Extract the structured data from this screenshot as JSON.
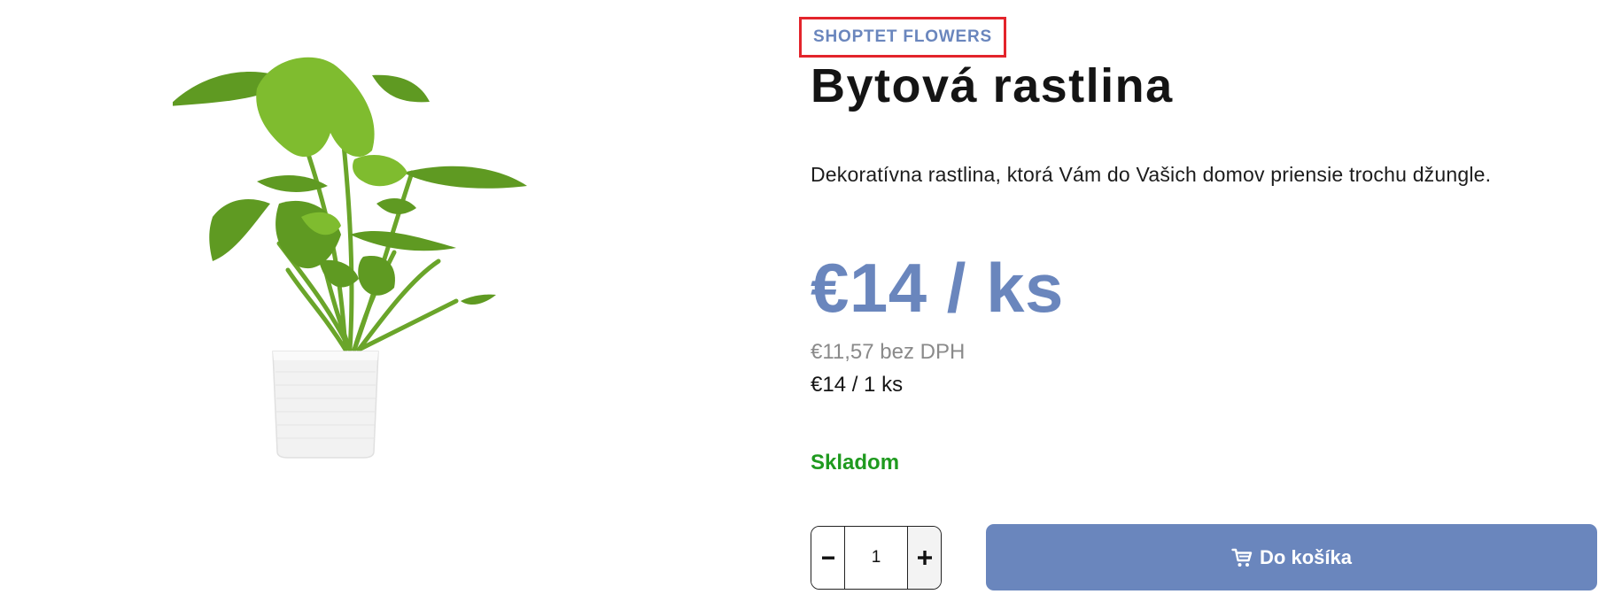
{
  "product": {
    "brand": "SHOPTET FLOWERS",
    "title": "Bytová rastlina",
    "description": "Dekoratívna rastlina, ktorá Vám do Vašich domov priensie trochu džungle.",
    "image_alt": "Monstera v bielom kvetináči"
  },
  "pricing": {
    "price_main": "€14 / ks",
    "price_without_vat": "€11,57 bez DPH",
    "price_per_unit": "€14 / 1 ks"
  },
  "availability": {
    "label": "Skladom",
    "color": "#1f9a1f"
  },
  "quantity": {
    "value": "1",
    "decrease_icon": "minus-icon",
    "increase_icon": "plus-icon"
  },
  "cart": {
    "button_label": "Do košíka",
    "icon": "cart-icon"
  },
  "theme": {
    "accent": "#6a86bd",
    "highlight_border": "#e3242b"
  }
}
